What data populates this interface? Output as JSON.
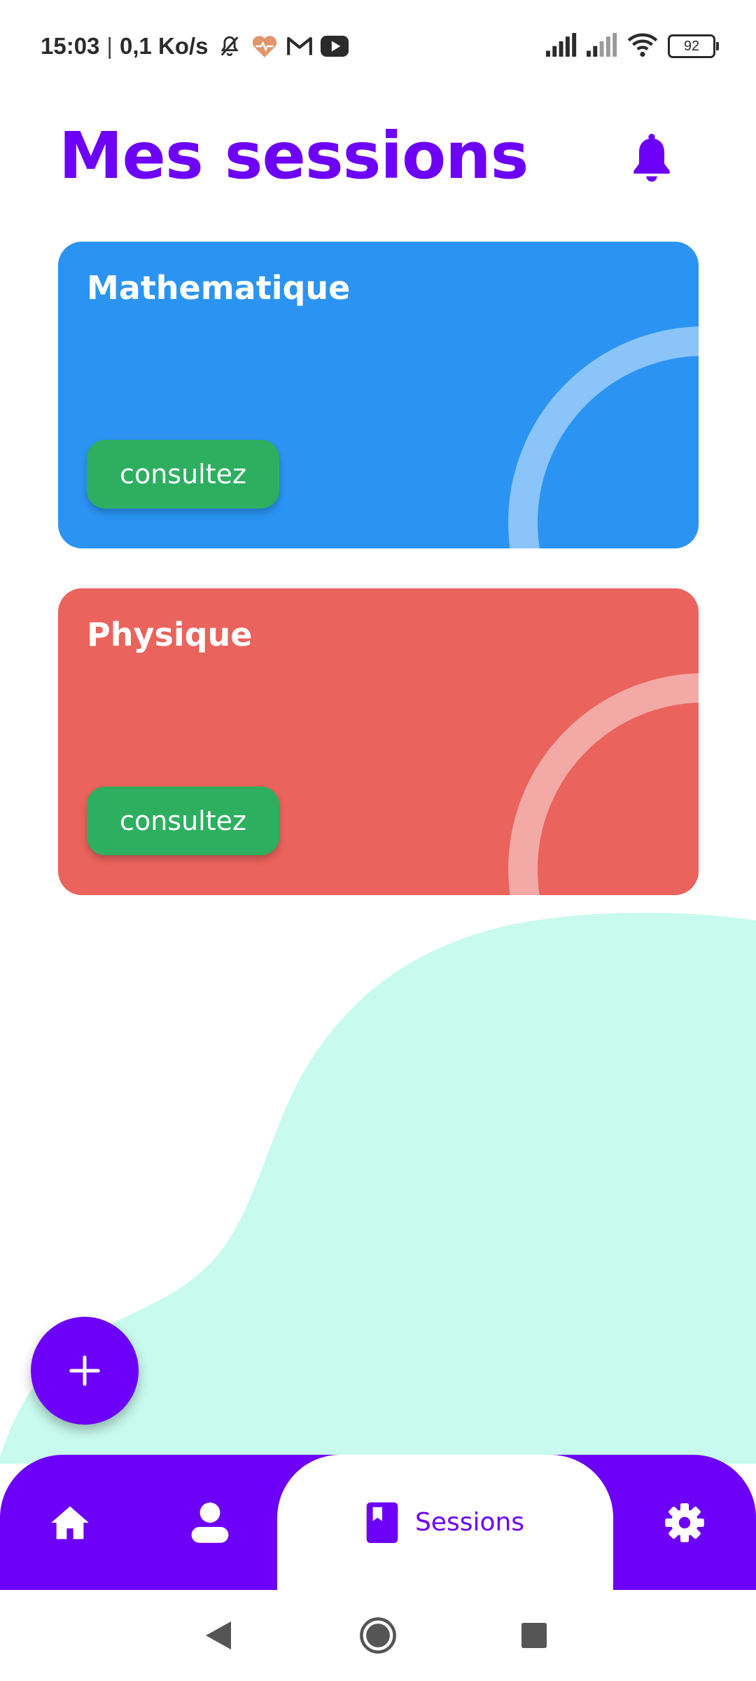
{
  "status_bar": {
    "time": "15:03",
    "separator": "|",
    "network_speed": "0,1 Ko/s",
    "left_icons": [
      "bell-off-icon",
      "heart-pulse-icon",
      "gmail-icon",
      "youtube-icon"
    ],
    "right_icons": [
      "signal-icon",
      "signal-weak-icon",
      "wifi-icon"
    ],
    "battery_level": "92"
  },
  "header": {
    "title": "Mes sessions",
    "notification_icon": "bell-icon"
  },
  "sessions": [
    {
      "title": "Mathematique",
      "button_label": "consultez",
      "color": "#2b94f3"
    },
    {
      "title": "Physique",
      "button_label": "consultez",
      "color": "#ea635c"
    }
  ],
  "fab": {
    "icon": "plus-icon"
  },
  "bottom_nav": {
    "items": [
      {
        "icon": "home-icon",
        "label": "",
        "active": false
      },
      {
        "icon": "person-icon",
        "label": "",
        "active": false
      },
      {
        "icon": "book-icon",
        "label": "Sessions",
        "active": true
      },
      {
        "icon": "gear-icon",
        "label": "",
        "active": false
      }
    ]
  },
  "colors": {
    "accent": "#6d00f7",
    "button_green": "#2daf5f",
    "blob": "#c8faee"
  },
  "system_nav": {
    "icons": [
      "back-icon",
      "home-circle-icon",
      "recents-icon"
    ]
  }
}
